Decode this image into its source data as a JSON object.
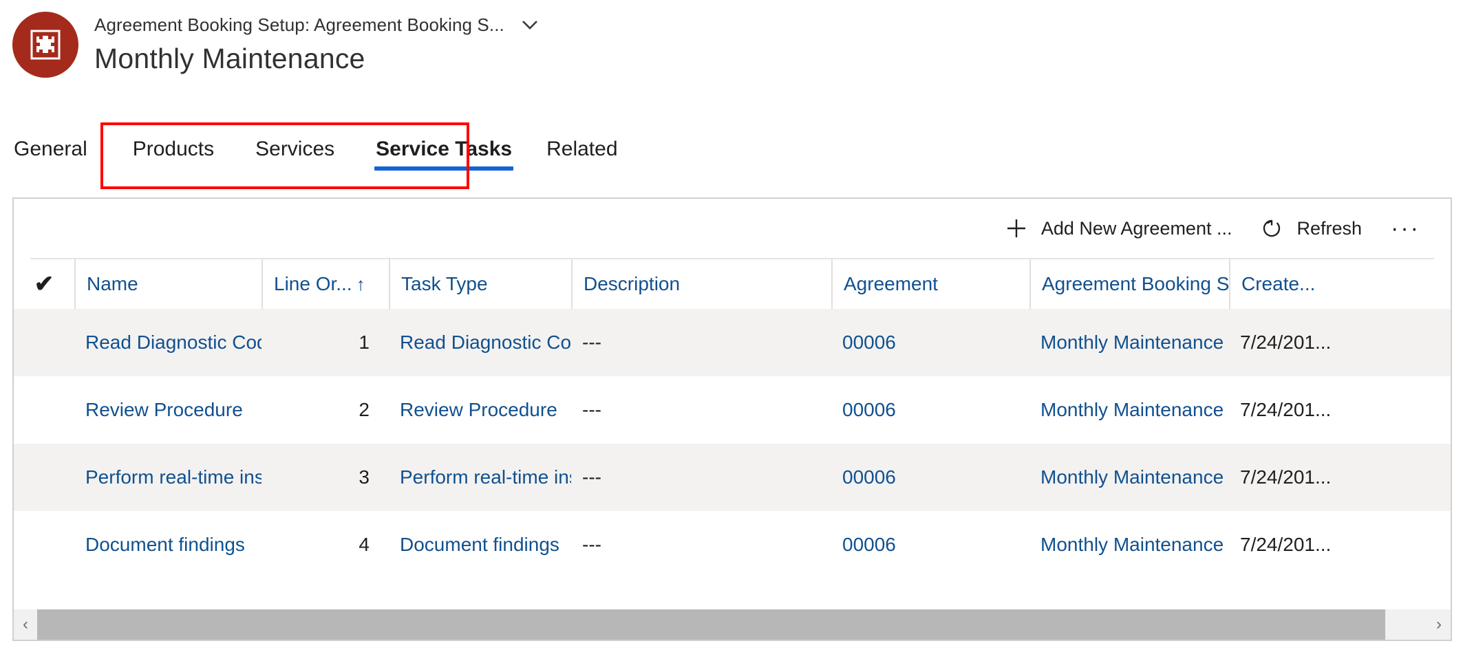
{
  "header": {
    "breadcrumb": "Agreement Booking Setup: Agreement Booking S...",
    "title": "Monthly Maintenance",
    "avatar_icon": "agreement-booking-setup-icon",
    "avatar_color": "#a42b1c",
    "chevron_icon": "chevron-down-icon"
  },
  "tabs": {
    "items": [
      {
        "label": "General",
        "active": false
      },
      {
        "label": "Products",
        "active": false
      },
      {
        "label": "Services",
        "active": false
      },
      {
        "label": "Service Tasks",
        "active": true
      },
      {
        "label": "Related",
        "active": false
      }
    ],
    "active_underline_color": "#1264d4",
    "annotation_color": "#ff0000"
  },
  "commandbar": {
    "add_label": "Add New Agreement ...",
    "add_icon": "plus-icon",
    "refresh_label": "Refresh",
    "refresh_icon": "refresh-icon",
    "overflow_label": "···",
    "overflow_icon": "more-horizontal-icon"
  },
  "grid": {
    "select_all_glyph": "✔",
    "columns": [
      {
        "key": "name",
        "label": "Name"
      },
      {
        "key": "lineorder",
        "label": "Line Or...",
        "sorted": true,
        "sort_glyph": "↑"
      },
      {
        "key": "tasktype",
        "label": "Task Type"
      },
      {
        "key": "desc",
        "label": "Description"
      },
      {
        "key": "agreement",
        "label": "Agreement"
      },
      {
        "key": "abs",
        "label": "Agreement Booking S..."
      },
      {
        "key": "created",
        "label": "Create..."
      }
    ],
    "rows": [
      {
        "name": "Read Diagnostic Codes",
        "lineorder": "1",
        "tasktype": "Read Diagnostic Codes",
        "desc": "---",
        "agreement": "00006",
        "abs": "Monthly Maintenance",
        "created": "7/24/201..."
      },
      {
        "name": "Review Procedure",
        "lineorder": "2",
        "tasktype": "Review Procedure",
        "desc": "---",
        "agreement": "00006",
        "abs": "Monthly Maintenance",
        "created": "7/24/201..."
      },
      {
        "name": "Perform real-time inspections",
        "lineorder": "3",
        "tasktype": "Perform real-time inspections",
        "desc": "---",
        "agreement": "00006",
        "abs": "Monthly Maintenance",
        "created": "7/24/201..."
      },
      {
        "name": "Document findings",
        "lineorder": "4",
        "tasktype": "Document findings",
        "desc": "---",
        "agreement": "00006",
        "abs": "Monthly Maintenance",
        "created": "7/24/201..."
      }
    ]
  },
  "scrollbar": {
    "left_arrow_glyph": "‹",
    "right_arrow_glyph": "›"
  },
  "colors": {
    "link": "#11508f",
    "accent": "#1264d4",
    "brand": "#a42b1c",
    "alt_row": "#f3f2f1"
  }
}
